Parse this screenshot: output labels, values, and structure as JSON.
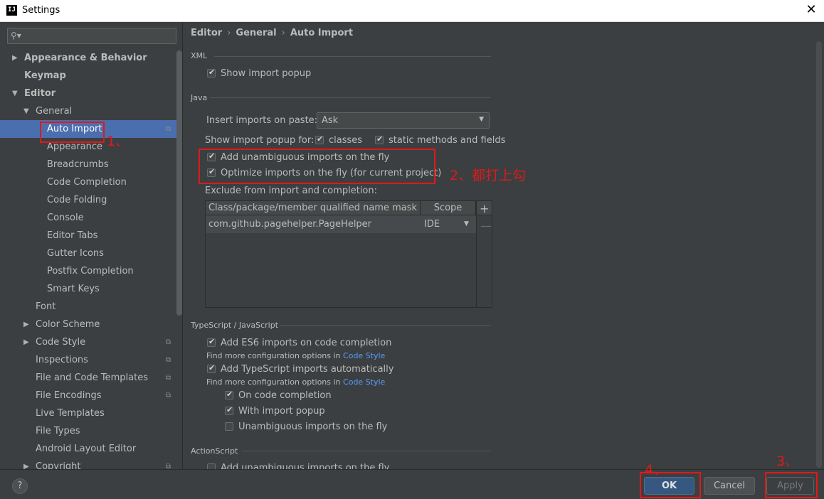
{
  "window": {
    "app_icon": "IJ",
    "title": "Settings",
    "close_glyph": "✕"
  },
  "search": {
    "placeholder": "",
    "icon": "search-icon"
  },
  "sidebar": {
    "items": [
      {
        "label": "Appearance & Behavior",
        "level": 0,
        "arrow": "▶",
        "bold": true
      },
      {
        "label": "Keymap",
        "level": 0,
        "arrow": "",
        "bold": true
      },
      {
        "label": "Editor",
        "level": 0,
        "arrow": "▼",
        "bold": true
      },
      {
        "label": "General",
        "level": 1,
        "arrow": "▼"
      },
      {
        "label": "Auto Import",
        "level": 2,
        "selected": true,
        "copy": true
      },
      {
        "label": "Appearance",
        "level": 2
      },
      {
        "label": "Breadcrumbs",
        "level": 2
      },
      {
        "label": "Code Completion",
        "level": 2
      },
      {
        "label": "Code Folding",
        "level": 2
      },
      {
        "label": "Console",
        "level": 2
      },
      {
        "label": "Editor Tabs",
        "level": 2
      },
      {
        "label": "Gutter Icons",
        "level": 2
      },
      {
        "label": "Postfix Completion",
        "level": 2
      },
      {
        "label": "Smart Keys",
        "level": 2
      },
      {
        "label": "Font",
        "level": 1
      },
      {
        "label": "Color Scheme",
        "level": 1,
        "arrow": "▶"
      },
      {
        "label": "Code Style",
        "level": 1,
        "arrow": "▶",
        "copy": true
      },
      {
        "label": "Inspections",
        "level": 1,
        "copy": true
      },
      {
        "label": "File and Code Templates",
        "level": 1,
        "copy": true
      },
      {
        "label": "File Encodings",
        "level": 1,
        "copy": true
      },
      {
        "label": "Live Templates",
        "level": 1
      },
      {
        "label": "File Types",
        "level": 1
      },
      {
        "label": "Android Layout Editor",
        "level": 1
      },
      {
        "label": "Copyright",
        "level": 1,
        "arrow": "▶",
        "copy": true
      }
    ]
  },
  "breadcrumb": {
    "items": [
      "Editor",
      "General",
      "Auto Import"
    ],
    "separator": "›"
  },
  "xml": {
    "section": "XML",
    "show_import_popup": {
      "label": "Show import popup",
      "checked": true
    }
  },
  "java": {
    "section": "Java",
    "insert_imports_label": "Insert imports on paste:",
    "insert_imports_value": "Ask",
    "show_popup_label": "Show import popup for:",
    "classes": {
      "label": "classes",
      "checked": true
    },
    "static_methods": {
      "label": "static methods and fields",
      "checked": true
    },
    "add_unambiguous": {
      "label": "Add unambiguous imports on the fly",
      "checked": true
    },
    "optimize_imports": {
      "label": "Optimize imports on the fly (for current project)",
      "checked": true
    },
    "exclude_label": "Exclude from import and completion:",
    "table": {
      "headers": [
        "Class/package/member qualified name mask",
        "Scope"
      ],
      "rows": [
        {
          "mask": "com.github.pagehelper.PageHelper",
          "scope": "IDE"
        }
      ],
      "add": "+",
      "remove": "—"
    }
  },
  "typescript": {
    "section": "TypeScript / JavaScript",
    "es6": {
      "label": "Add ES6 imports on code completion",
      "checked": true
    },
    "find_more_1": "Find more configuration options in ",
    "code_style_link_1": "Code Style",
    "ts_auto": {
      "label": "Add TypeScript imports automatically",
      "checked": true
    },
    "find_more_2": "Find more configuration options in ",
    "code_style_link_2": "Code Style",
    "on_completion": {
      "label": "On code completion",
      "checked": true
    },
    "with_popup": {
      "label": "With import popup",
      "checked": true
    },
    "unambiguous": {
      "label": "Unambiguous imports on the fly",
      "checked": false
    }
  },
  "actionscript": {
    "section": "ActionScript",
    "partial": {
      "label": "Add unambiguous imports on the fly",
      "checked": false
    }
  },
  "footer": {
    "help": "?",
    "ok": "OK",
    "cancel": "Cancel",
    "apply": "Apply"
  },
  "annotations": {
    "a1": "1、",
    "a2": "2、都打上勾",
    "a3": "3、",
    "a4": "4、",
    "color": "#e01919"
  }
}
